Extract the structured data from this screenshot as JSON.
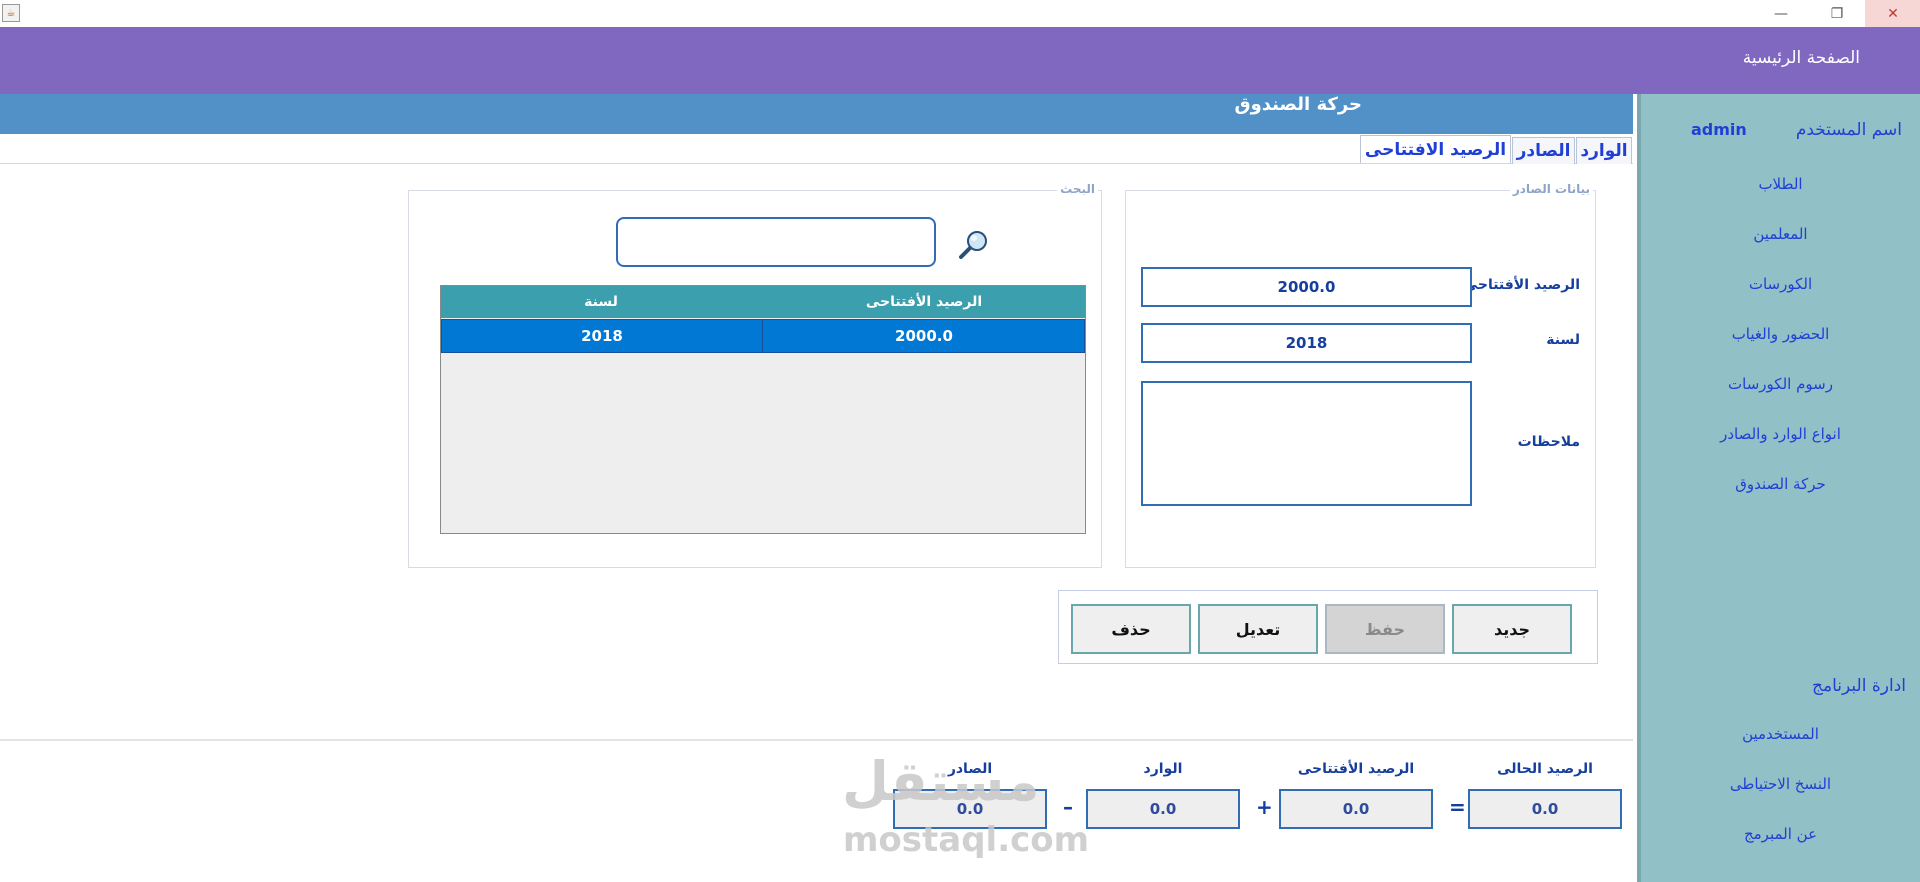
{
  "window": {
    "app_icon": "java-icon",
    "minimize_glyph": "—",
    "restore_glyph": "❐",
    "close_glyph": "✕"
  },
  "header": {
    "title": "الصفحة الرئيسية"
  },
  "sidebar": {
    "user_label": "اسم المستخدم",
    "user_value": "admin",
    "items": [
      "الطلاب",
      "المعلمين",
      "الكورسات",
      "الحضور والغياب",
      "رسوم الكورسات",
      "انواع الوارد والصادر",
      "حركة الصندوق"
    ],
    "admin_section": "ادارة البرنامج",
    "admin_items": [
      "المستخدمين",
      "النسخ الاحتياطى",
      "عن المبرمج"
    ]
  },
  "page": {
    "title": "حركة الصندوق",
    "tabs": [
      "الوارد",
      "الصادر",
      "الرصيد الافتتاحى"
    ],
    "active_tab": "الرصيد الافتتاحى"
  },
  "form": {
    "group_title": "بيانات الصادر",
    "opening_balance_label": "الرصيد الأفتتاحى",
    "opening_balance_value": "2000.0",
    "year_label": "لسنة",
    "year_value": "2018",
    "notes_label": "ملاحظات",
    "notes_value": ""
  },
  "search": {
    "group_title": "البحث",
    "value": "",
    "icon": "search-icon"
  },
  "table": {
    "columns": [
      "الرصيد الأفتتاحى",
      "لسنة"
    ],
    "rows": [
      [
        "2000.0",
        "2018"
      ]
    ]
  },
  "buttons": {
    "new": "جديد",
    "save": "حفظ",
    "edit": "تعديل",
    "delete": "حذف"
  },
  "summary": {
    "current_label": "الرصيد الحالى",
    "current_value": "0.0",
    "opening_label": "الرصيد الأفتتاحى",
    "opening_value": "0.0",
    "incoming_label": "الوارد",
    "incoming_value": "0.0",
    "outgoing_label": "الصادر",
    "outgoing_value": "0.0",
    "op_equals": "=",
    "op_plus": "+",
    "op_minus": "–"
  },
  "watermark": {
    "text": "مستقل",
    "sub": "mostaql.com"
  }
}
